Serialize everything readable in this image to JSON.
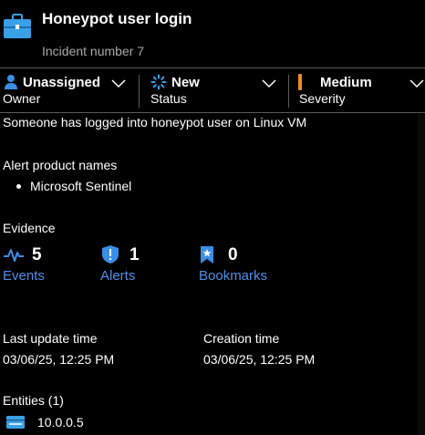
{
  "incident": {
    "title": "Honeypot user login",
    "subtitle": "Incident number 7",
    "icon": "briefcase-icon"
  },
  "fields": {
    "owner": {
      "value": "Unassigned",
      "label": "Owner",
      "icon": "person-icon"
    },
    "status": {
      "value": "New",
      "label": "Status",
      "icon": "spinner-icon"
    },
    "severity": {
      "value": "Medium",
      "label": "Severity",
      "color": "#f08a24"
    }
  },
  "description": "Someone has logged into honeypot user on Linux VM",
  "alert_products": {
    "heading": "Alert product names",
    "items": [
      "Microsoft Sentinel"
    ]
  },
  "evidence": {
    "heading": "Evidence",
    "events": {
      "count": "5",
      "label": "Events",
      "icon": "pulse-icon"
    },
    "alerts": {
      "count": "1",
      "label": "Alerts",
      "icon": "shield-alert-icon"
    },
    "bookmarks": {
      "count": "0",
      "label": "Bookmarks",
      "icon": "bookmark-icon"
    }
  },
  "times": {
    "last_update": {
      "label": "Last update time",
      "value": "03/06/25, 12:25 PM"
    },
    "creation": {
      "label": "Creation time",
      "value": "03/06/25, 12:25 PM"
    }
  },
  "entities": {
    "heading": "Entities (1)",
    "items": [
      {
        "label": "10.0.0.5",
        "icon": "server-icon"
      }
    ]
  },
  "colors": {
    "background": "#000000",
    "link": "#4f8fe8",
    "icon_blue": "#3b8ee6",
    "divider": "#5a5a5a"
  }
}
